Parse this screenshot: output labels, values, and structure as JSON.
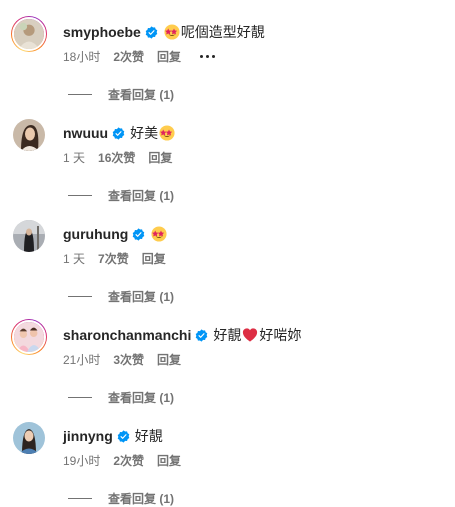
{
  "colors": {
    "text_primary": "#262626",
    "text_secondary": "#737373",
    "verified_blue": "#0095f6",
    "heart_red": "#e0245e",
    "emoji_yellow": "#ffcc4d",
    "emoji_heart_eyes": "#e0245e"
  },
  "comments": [
    {
      "username": "smyphoebe",
      "verified": true,
      "text_before": "",
      "emoji": "star-struck-emoji",
      "text_after": "呢個造型好靚",
      "time": "18小时",
      "likes": "2次赞",
      "reply": "回复",
      "more_icon": "more-horizontal-icon",
      "view_replies": "查看回复 (1)",
      "avatar": "avatar-photo-smyphoebe",
      "story_ring": true
    },
    {
      "username": "nwuuu",
      "verified": true,
      "text_before": "好美",
      "emoji": "star-struck-emoji",
      "text_after": "",
      "time": "1 天",
      "likes": "16次赞",
      "reply": "回复",
      "view_replies": "查看回复 (1)",
      "avatar": "avatar-photo-nwuuu",
      "story_ring": false
    },
    {
      "username": "guruhung",
      "verified": true,
      "text_before": "",
      "emoji": "star-struck-emoji",
      "text_after": "",
      "time": "1 天",
      "likes": "7次赞",
      "reply": "回复",
      "view_replies": "查看回复 (1)",
      "avatar": "avatar-photo-guruhung",
      "story_ring": false
    },
    {
      "username": "sharonchanmanchi",
      "verified": true,
      "text_before": "好靚",
      "emoji": "red-heart-emoji",
      "text_after": "好啱妳",
      "time": "21小时",
      "likes": "3次赞",
      "reply": "回复",
      "view_replies": "查看回复 (1)",
      "avatar": "avatar-photo-sharonchanmanchi",
      "story_ring": true
    },
    {
      "username": "jinnyng",
      "verified": true,
      "text_before": "好靚",
      "emoji": "",
      "text_after": "",
      "time": "19小时",
      "likes": "2次赞",
      "reply": "回复",
      "view_replies": "查看回复 (1)",
      "avatar": "avatar-photo-jinnyng",
      "story_ring": false
    }
  ]
}
